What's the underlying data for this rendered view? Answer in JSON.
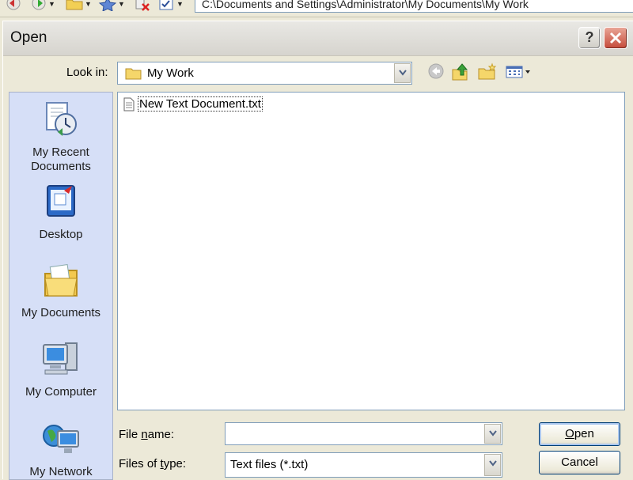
{
  "toolbar": {
    "address": "C:\\Documents and Settings\\Administrator\\My Documents\\My Work",
    "icons": [
      "back-icon",
      "forward-icon",
      "folder-icon",
      "favorites-icon",
      "delete-icon",
      "checklist-icon"
    ]
  },
  "dialog": {
    "title": "Open",
    "help_label": "?",
    "look_in_label": "Look in:",
    "look_in_value": "My Work",
    "places": [
      {
        "label": "My Recent\nDocuments",
        "icon": "recent-documents-icon"
      },
      {
        "label": "Desktop",
        "icon": "desktop-icon"
      },
      {
        "label": "My Documents",
        "icon": "my-documents-icon"
      },
      {
        "label": "My Computer",
        "icon": "my-computer-icon"
      },
      {
        "label": "My Network",
        "icon": "my-network-icon"
      }
    ],
    "files": [
      {
        "name": "New Text Document.txt",
        "icon": "text-file-icon"
      }
    ],
    "file_name_label": "File name:",
    "file_name_value": "",
    "files_of_type_label": "Files of type:",
    "files_of_type_value": "Text files (*.txt)",
    "open_label": "Open",
    "cancel_label": "Cancel"
  },
  "colors": {
    "dialog_bg": "#ece9d8",
    "places_bg": "#d6dff7",
    "input_border": "#7f9db9",
    "close_red": "#c54a3a"
  }
}
